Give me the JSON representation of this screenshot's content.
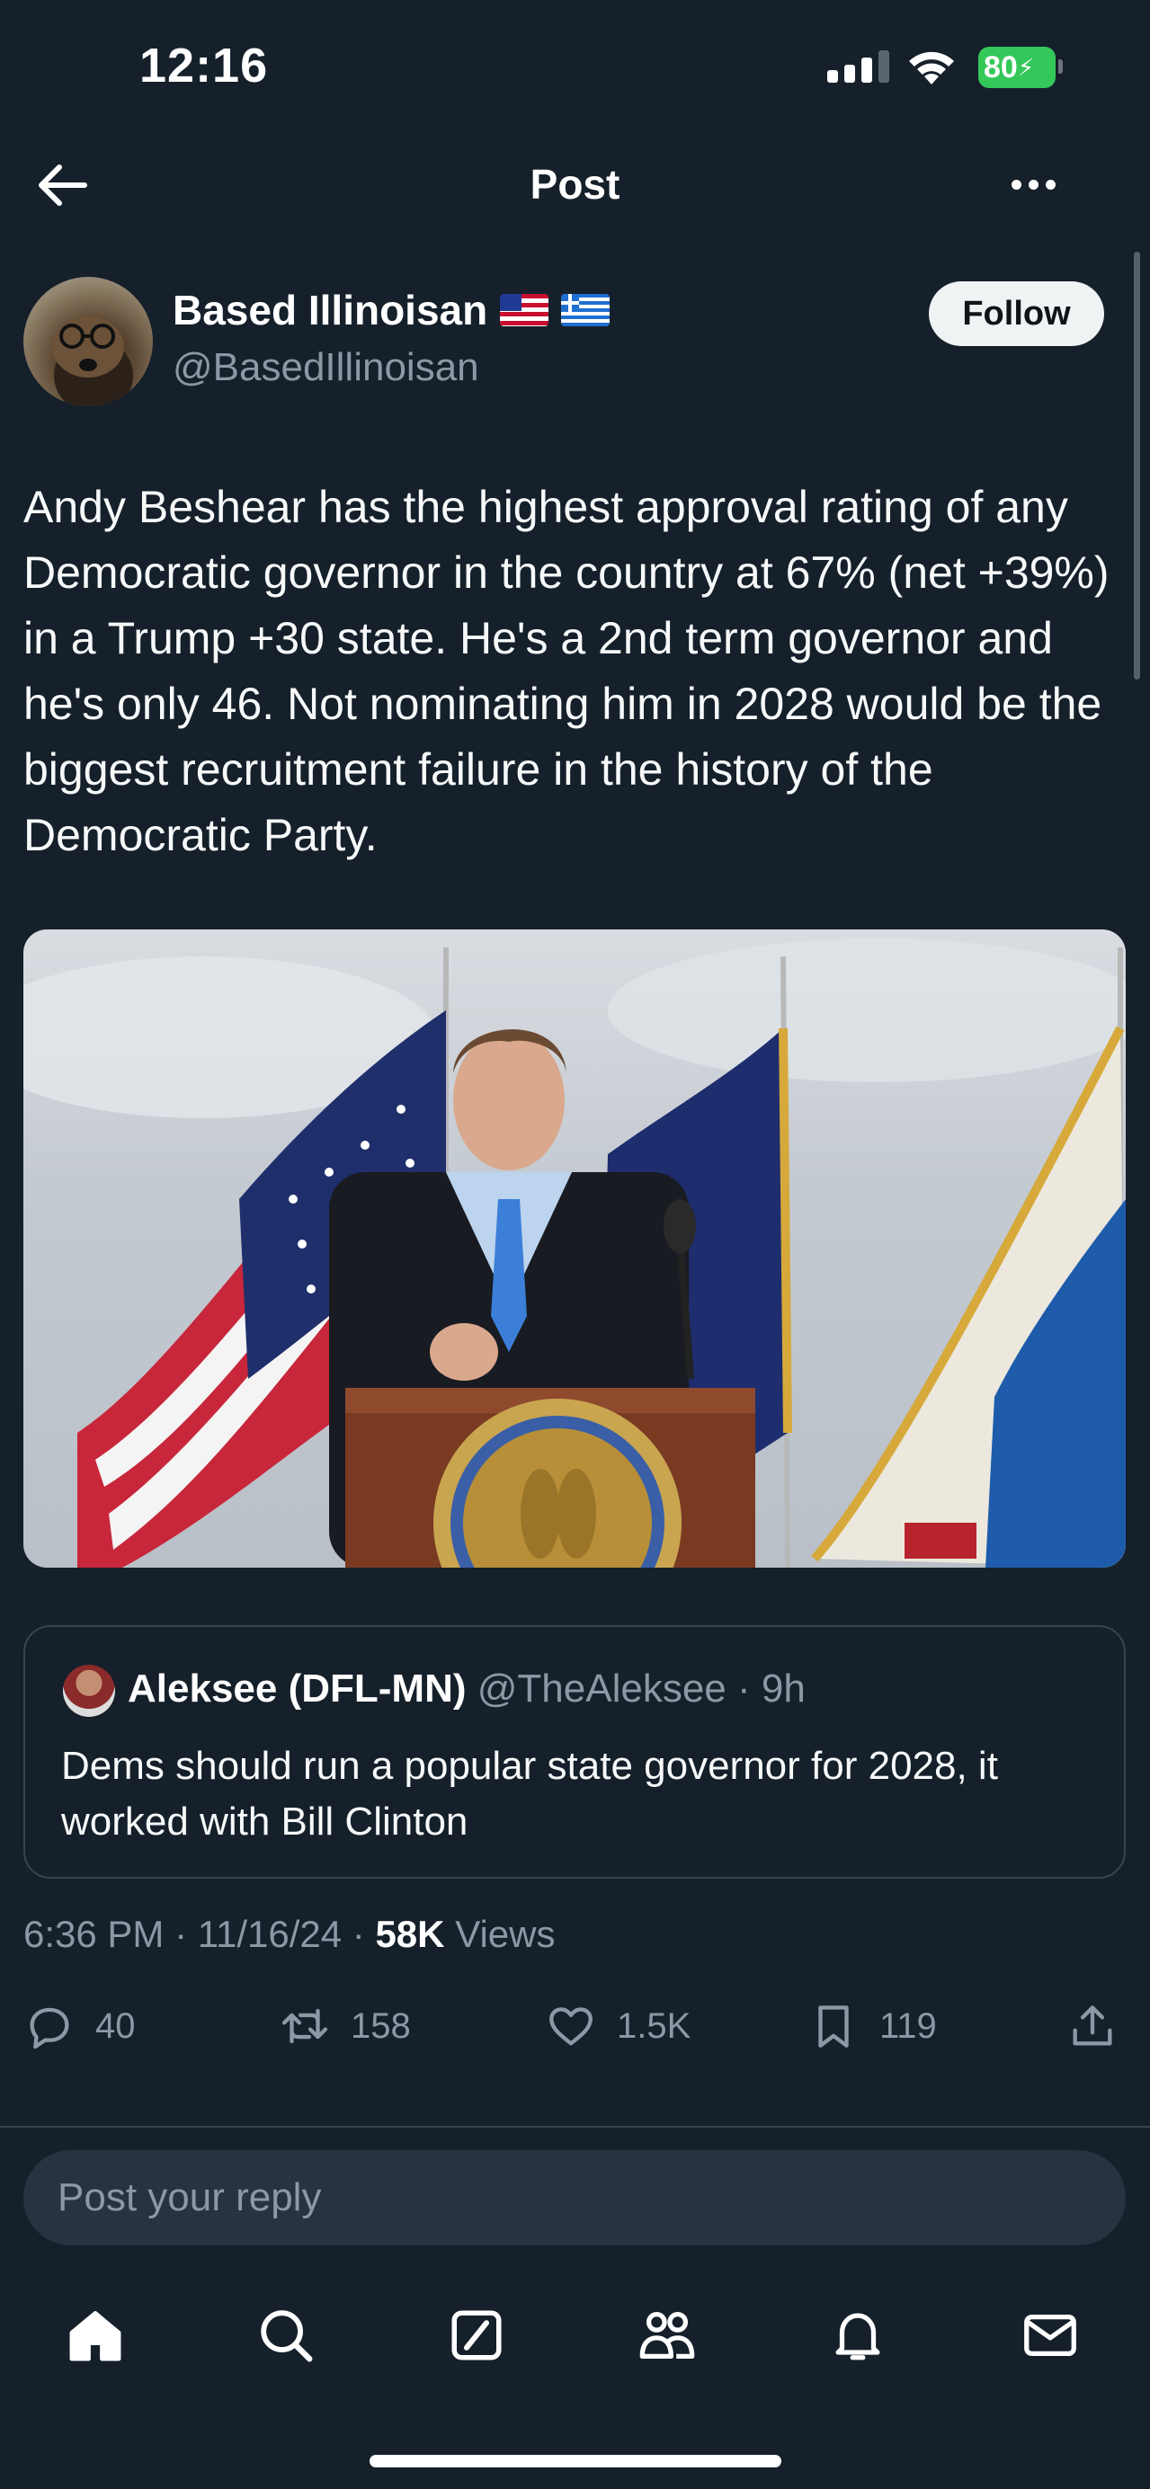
{
  "status_bar": {
    "time": "12:16",
    "battery": "80",
    "battery_color": "#34c759"
  },
  "header": {
    "title": "Post",
    "back_icon": "arrow-left-icon",
    "more_icon": "ellipsis-icon"
  },
  "author": {
    "display_name": "Based Illinoisan",
    "handle": "@BasedIllinoisan",
    "follow_label": "Follow",
    "flags": [
      "us-flag",
      "greece-flag"
    ]
  },
  "tweet": {
    "text": "Andy Beshear has the highest approval rating of any Democratic governor in the country at 67% (net +39%) in a Trump +30 state. He's a 2nd term governor and he's only 46. Not nominating him in 2028 would be the biggest recruitment failure in the history of the Democratic Party."
  },
  "quoted": {
    "name": "Aleksee (DFL-MN)",
    "handle": "@TheAleksee",
    "time": "9h",
    "text": "Dems should run a popular state governor for 2028, it worked with Bill Clinton"
  },
  "meta": {
    "time": "6:36 PM",
    "date": "11/16/24",
    "views_count": "58K",
    "views_label": "Views"
  },
  "actions": {
    "replies": "40",
    "reposts": "158",
    "likes": "1.5K",
    "bookmarks": "119"
  },
  "reply": {
    "placeholder": "Post your reply"
  },
  "tab_bar": [
    "home-icon",
    "search-icon",
    "compose-icon",
    "communities-icon",
    "notifications-icon",
    "messages-icon"
  ],
  "colors": {
    "background": "#15202b",
    "secondary_text": "#8b98a5",
    "border": "#38444d"
  }
}
